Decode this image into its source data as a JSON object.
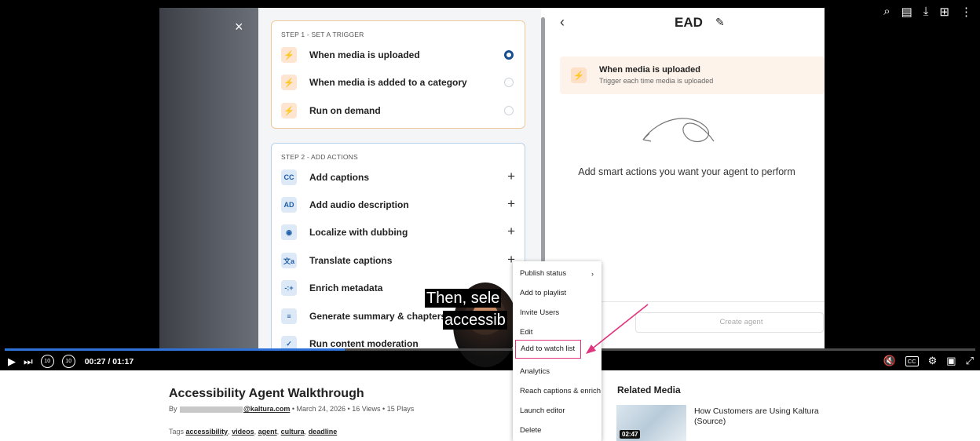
{
  "player": {
    "close_glyph": "×",
    "step1": {
      "title": "STEP 1 - SET A TRIGGER",
      "options": [
        {
          "label": "When media is uploaded",
          "selected": true
        },
        {
          "label": "When media is added to a category",
          "selected": false
        },
        {
          "label": "Run on demand",
          "selected": false
        }
      ]
    },
    "step2": {
      "title": "STEP 2 - ADD ACTIONS",
      "actions": [
        {
          "label": "Add captions",
          "icon": "CC",
          "plus": true
        },
        {
          "label": "Add audio description",
          "icon": "AD",
          "plus": true
        },
        {
          "label": "Localize with dubbing",
          "icon": "◉",
          "plus": true
        },
        {
          "label": "Translate captions",
          "icon": "文a",
          "plus": true
        },
        {
          "label": "Enrich metadata",
          "icon": "-:+",
          "plus": false
        },
        {
          "label": "Generate summary & chapters",
          "icon": "≡",
          "plus": false
        },
        {
          "label": "Run content moderation",
          "icon": "✓",
          "plus": false
        }
      ]
    },
    "agent": {
      "back_glyph": "‹",
      "title": "EAD",
      "trigger_title": "When media is uploaded",
      "trigger_sub": "Trigger each time media is uploaded",
      "empty_text": "Add smart actions you want your agent to perform",
      "create_label": "Create agent"
    },
    "caption_line1": "Then, sele",
    "caption_line2": "accessib",
    "time": "00:27 / 01:17",
    "progress_fraction": 0.35,
    "skip_back": "10",
    "skip_fwd": "10",
    "cc_label": "CC"
  },
  "context_menu": {
    "items": [
      {
        "label": "Publish status",
        "submenu": true
      },
      {
        "label": "Add to playlist"
      },
      {
        "label": "Invite Users"
      },
      {
        "label": "Edit"
      },
      {
        "label": "Add to watch list",
        "highlighted": true
      },
      {
        "label": "Analytics"
      },
      {
        "label": "Reach captions & enrich"
      },
      {
        "label": "Launch editor"
      },
      {
        "label": "Delete"
      }
    ]
  },
  "media": {
    "title": "Accessibility Agent Walkthrough",
    "by_prefix": "By",
    "by_email": "@kaltura.com",
    "date": "March 24, 2026",
    "views": "16 Views",
    "plays": "15 Plays",
    "tags_prefix": "Tags",
    "tags": [
      "accessibility",
      "videos",
      "agent",
      "cultura",
      "deadline"
    ]
  },
  "related": {
    "title": "Related Media",
    "item_name": "How Customers are Using Kaltura (Source)",
    "item_duration": "02:47"
  },
  "colors": {
    "accent_blue": "#2f73d8",
    "highlight_pink": "#e0347f",
    "trigger_orange": "#f07622"
  }
}
